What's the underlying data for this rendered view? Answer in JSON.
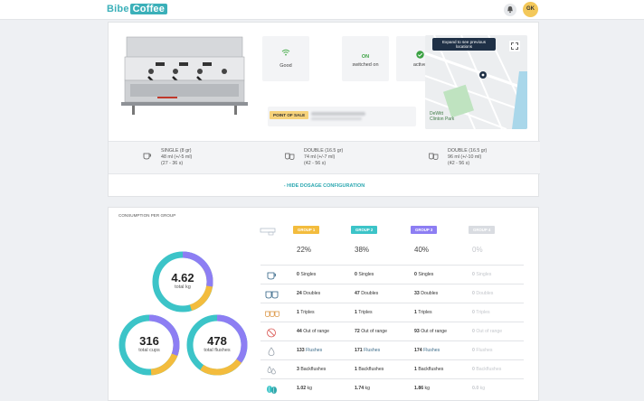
{
  "header": {
    "logo_left": "Bibe",
    "logo_right": "Coffee",
    "avatar_initials": "GK"
  },
  "status": [
    {
      "label": "Good",
      "icon": "wifi-icon"
    },
    {
      "label": "ON",
      "sub": "switched on"
    },
    {
      "label": "active",
      "icon": "check-icon"
    }
  ],
  "pos": {
    "badge": "POINT OF SALE"
  },
  "map": {
    "tooltip": "Expand to see previous locations",
    "place": "DeWitt Clinton Park"
  },
  "dosage": [
    {
      "line1": "SINGLE (8 gr)",
      "line2": "48 ml (+/-5 ml)",
      "line3": "(27 - 36 s)",
      "icon": "single-cup-icon"
    },
    {
      "line1": "DOUBLE (16.5 gr)",
      "line2": "74 ml (+/-7 ml)",
      "line3": "(42 - 56 s)",
      "icon": "double-cup-icon"
    },
    {
      "line1": "DOUBLE (16.5 gr)",
      "line2": "96 ml (+/-10 ml)",
      "line3": "(42 - 56 s)",
      "icon": "double-cup-icon"
    }
  ],
  "hide_dosage_label": "- HIDE DOSAGE CONFIGURATION",
  "consumption": {
    "title": "CONSUMPTION PER GROUP",
    "kg": {
      "value": "4.62",
      "label": "total kg"
    },
    "cups": {
      "value": "316",
      "label": "total cups"
    },
    "flushes": {
      "value": "478",
      "label": "total flushes"
    },
    "groups": [
      {
        "name": "GROUP 1",
        "pct": "22%",
        "color": "#f3bc3d"
      },
      {
        "name": "GROUP 2",
        "pct": "38%",
        "color": "#3cc4c8"
      },
      {
        "name": "GROUP 3",
        "pct": "40%",
        "color": "#8d7ef3"
      },
      {
        "name": "GROUP 4",
        "pct": "0%",
        "color": "#d9dce1"
      }
    ],
    "rows": [
      {
        "icon": "single-cup-icon",
        "cells": [
          [
            "0",
            "Singles"
          ],
          [
            "0",
            "Singles"
          ],
          [
            "0",
            "Singles"
          ],
          [
            "0",
            "Singles"
          ]
        ]
      },
      {
        "icon": "double-cup-icon",
        "cells": [
          [
            "24",
            "Doubles"
          ],
          [
            "47",
            "Doubles"
          ],
          [
            "33",
            "Doubles"
          ],
          [
            "0",
            "Doubles"
          ]
        ]
      },
      {
        "icon": "triple-cup-icon",
        "cells": [
          [
            "1",
            "Triples"
          ],
          [
            "1",
            "Triples"
          ],
          [
            "1",
            "Triples"
          ],
          [
            "0",
            "Triples"
          ]
        ]
      },
      {
        "icon": "out-of-range-icon",
        "cells": [
          [
            "44",
            "Out of range"
          ],
          [
            "72",
            "Out of range"
          ],
          [
            "93",
            "Out of range"
          ],
          [
            "0",
            "Out of range"
          ]
        ]
      },
      {
        "icon": "flush-icon",
        "cells": [
          [
            "133",
            "Flushes"
          ],
          [
            "171",
            "Flushes"
          ],
          [
            "174",
            "Flushes"
          ],
          [
            "0",
            "Flushes"
          ]
        ]
      },
      {
        "icon": "backflush-icon",
        "cells": [
          [
            "3",
            "Backflushes"
          ],
          [
            "1",
            "Backflushes"
          ],
          [
            "1",
            "Backflushes"
          ],
          [
            "0",
            "Backflushes"
          ]
        ]
      },
      {
        "icon": "coffee-beans-icon",
        "cells": [
          [
            "1.02",
            "kg"
          ],
          [
            "1.74",
            "kg"
          ],
          [
            "1.86",
            "kg"
          ],
          [
            "0.0",
            "kg"
          ]
        ]
      }
    ]
  }
}
